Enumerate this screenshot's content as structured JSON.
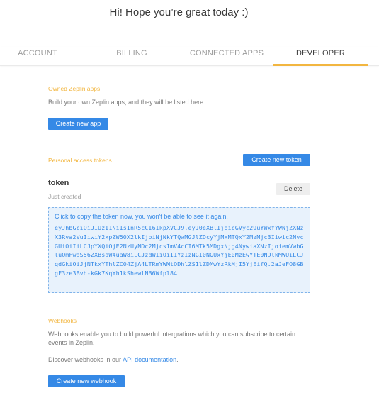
{
  "greeting": "Hi! Hope you’re great today :)",
  "tabs": [
    {
      "label": "ACCOUNT"
    },
    {
      "label": "BILLING"
    },
    {
      "label": "CONNECTED APPS"
    },
    {
      "label": "DEVELOPER",
      "active": true
    }
  ],
  "owned_apps": {
    "title": "Owned Zeplin apps",
    "description": "Build your own Zeplin apps, and they will be listed here.",
    "button": "Create new app"
  },
  "tokens": {
    "title": "Personal access tokens",
    "create_button": "Create new token",
    "token": {
      "name": "token",
      "created": "Just created",
      "delete_label": "Delete",
      "hint": "Click to copy the token now, you won't be able to see it again.",
      "value": "eyJhbGciOiJIUzI1NiIsInR5cCI6IkpXVCJ9.eyJ0eXBlIjoicGVyc29uYWxfYWNjZXNzX3Rva2VuIiwiY2xpZW50X2lkIjoiNjNkYTQwMGJlZDcyYjMxMTQxY2MzMjc3Iiwic2NvcGUiOiIiLCJpYXQiOjE2NzUyNDc2MjcsImV4cCI6MTk5MDgxNjg4NywiaXNzIjoiemVwbGluOmFwaS56ZXBsaW4uaW8iLCJzdWIiOiI1YzIzNGI0NGUxYjE0MzEwYTE0NDlkMWUiLCJqdGkiOiJjNTkxYThlZC04ZjA4LTRmYWMtODhlZS1lZDMwYzRkMjI5YjEifQ.2aJeFO8GBgF3ze3Bvh-kGk7KqYh1kShewlNB6Wfpl84"
    }
  },
  "webhooks": {
    "title": "Webhooks",
    "description": "Webhooks enable you to build powerful intergrations which you can subscribe to certain events in Zeplin.",
    "discover_prefix": "Discover webhooks in our ",
    "discover_link": "API documentation",
    "discover_suffix": ".",
    "button": "Create new webhook"
  }
}
